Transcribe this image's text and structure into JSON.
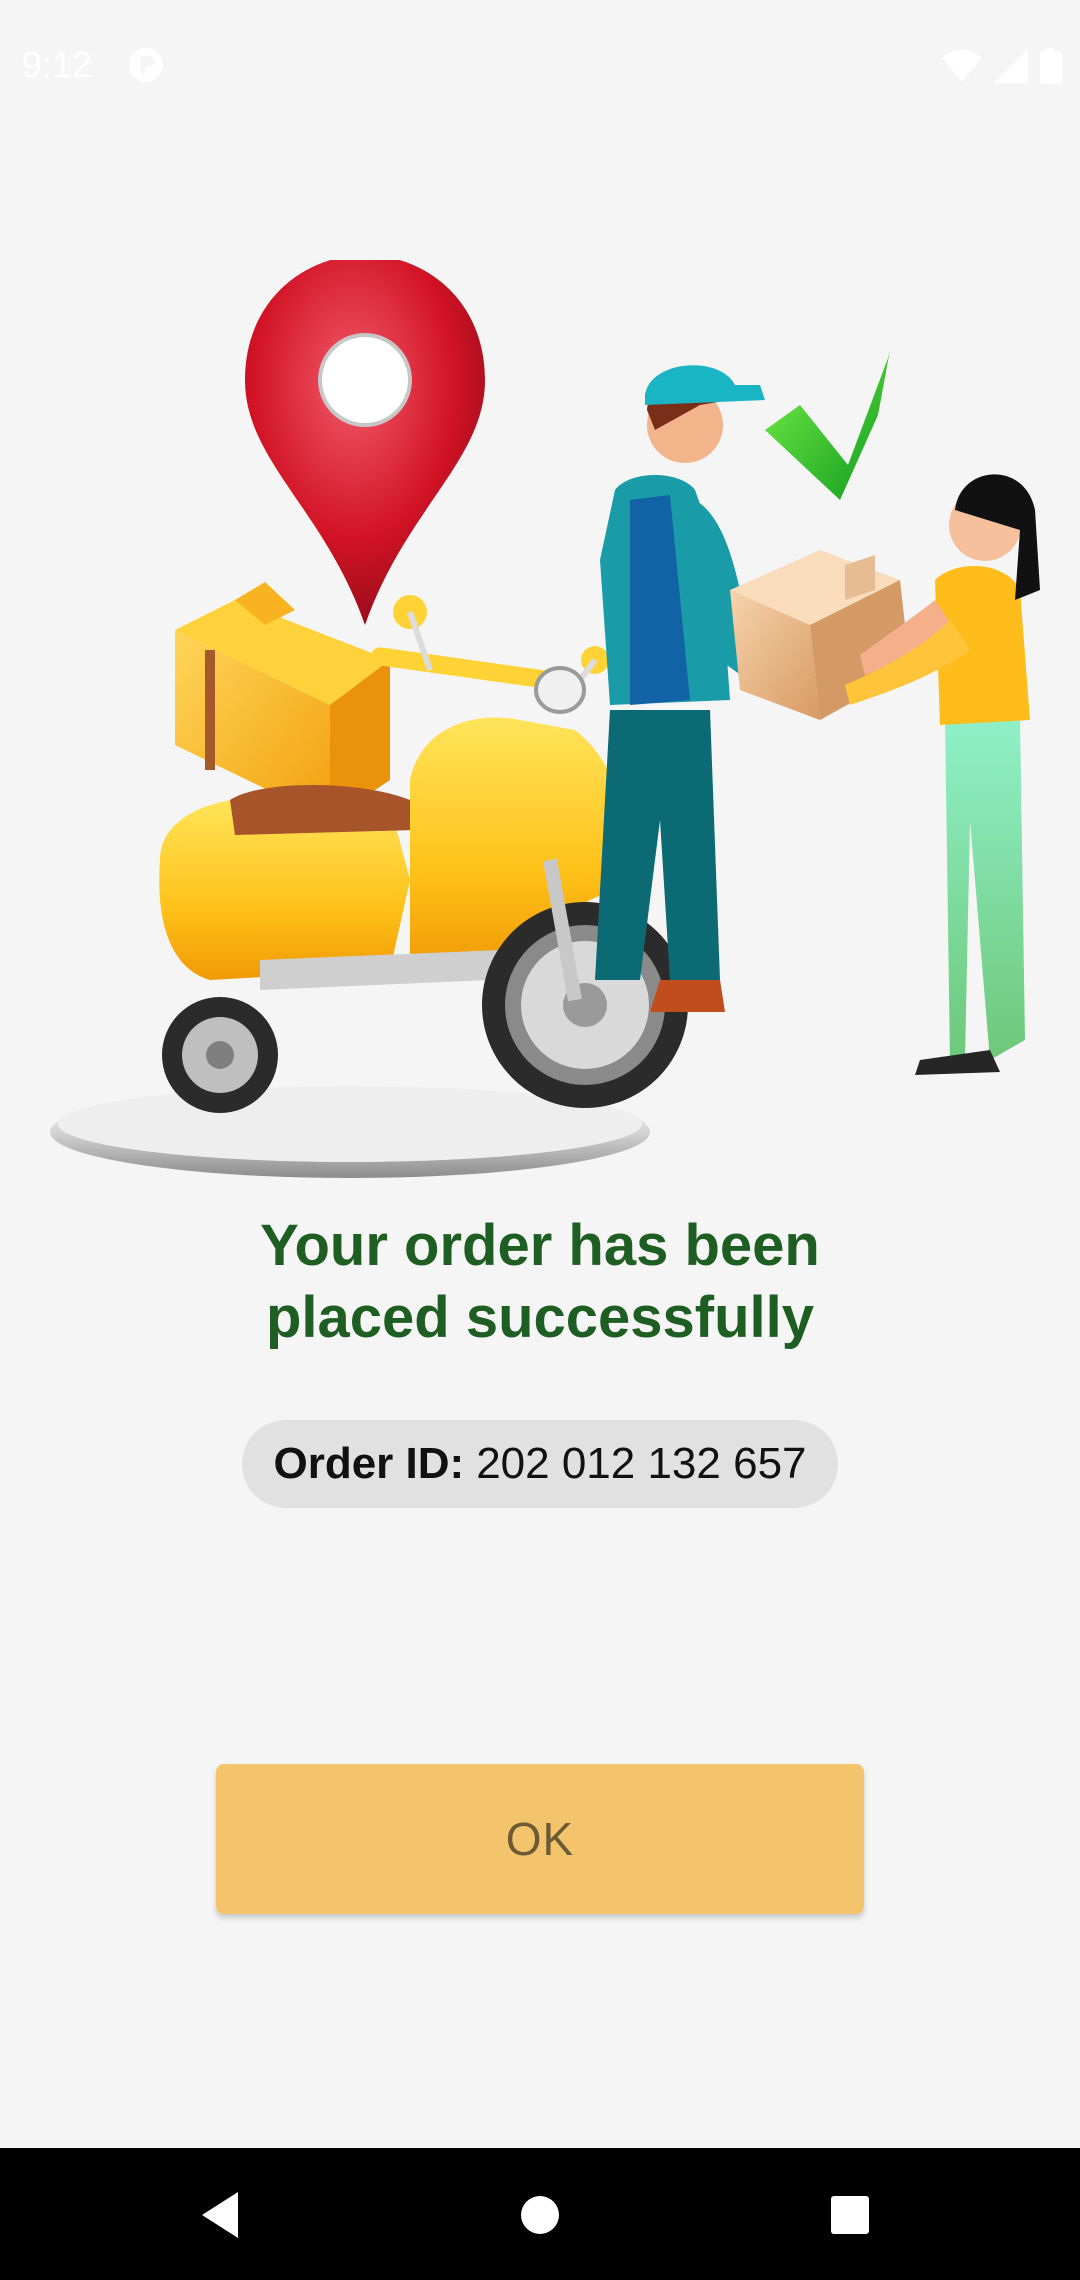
{
  "status_bar": {
    "time": "9:12",
    "icons": [
      "app-notification-icon",
      "wifi-icon",
      "cellular-signal-icon",
      "battery-icon"
    ]
  },
  "illustration": {
    "icons": [
      "map-pin-icon",
      "check-mark-icon",
      "delivery-scooter-illustration",
      "courier-illustration",
      "customer-illustration",
      "package-box-illustration"
    ]
  },
  "confirmation": {
    "headline_line1": "Your order has been",
    "headline_line2": "placed successfully",
    "order_id_label": "Order ID:",
    "order_id_value": "202 012 132 657"
  },
  "actions": {
    "ok_label": "OK"
  },
  "nav_bar": {
    "icons": [
      "back-icon",
      "home-icon",
      "recents-icon"
    ]
  },
  "colors": {
    "background": "#f5f5f5",
    "headline": "#1f5e22",
    "order_pill": "#e1e1e1",
    "ok_button": "#f3c46c",
    "ok_text": "#6b5a34",
    "nav_bar": "#000000"
  }
}
